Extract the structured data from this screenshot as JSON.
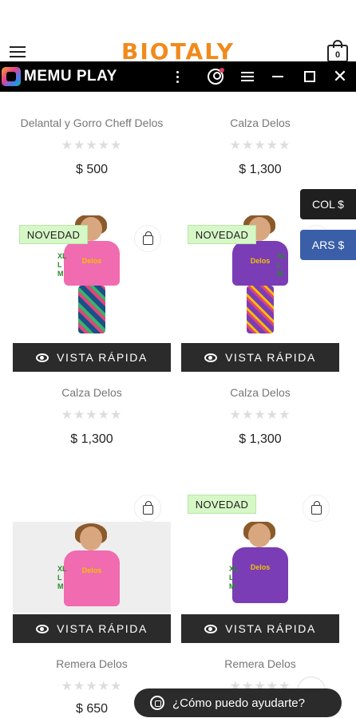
{
  "header": {
    "logo_text": "BIOTALY",
    "cart_count": "0",
    "accent_color": "#f08a1c"
  },
  "emulator_bar": {
    "title": "MEMU PLAY",
    "icons": [
      "memu-logo-icon",
      "kebab-menu-icon",
      "account-icon",
      "menu-lines-icon",
      "minimize-icon",
      "maximize-icon",
      "close-icon"
    ]
  },
  "currency_switcher": {
    "options": [
      "COL $",
      "ARS $"
    ],
    "active": "ARS $"
  },
  "quick_view_label": "VISTA RÁPIDA",
  "badge_label": "NOVEDAD",
  "stars": "★★★★★",
  "products": [
    {
      "name": "Delantal y Gorro Cheff Delos",
      "price": "$ 500",
      "rating": 0
    },
    {
      "name": "Calza Delos",
      "price": "$ 1,300",
      "rating": 0
    },
    {
      "name": "Calza Delos",
      "price": "$ 1,300",
      "rating": 0,
      "badge": true,
      "shirt_color": "#f06bb0",
      "legs_color": "#1b4f8a",
      "print": "Delos"
    },
    {
      "name": "Calza Delos",
      "price": "$ 1,300",
      "rating": 0,
      "badge": true,
      "shirt_color": "#7a3db5",
      "legs_color": "#7a3db5",
      "print": "Delos"
    },
    {
      "name": "Remera Delos",
      "price": "$ 650",
      "rating": 0,
      "badge": false,
      "shirt_color": "#f06bb0",
      "legs_color": "#1b4f8a",
      "print": "Delos"
    },
    {
      "name": "Remera Delos",
      "price": "",
      "rating": 0,
      "badge": true,
      "shirt_color": "#7a3db5",
      "legs_color": "#5a2c8a",
      "print": "Delos"
    }
  ],
  "size_labels": [
    "XL",
    "L",
    "M"
  ],
  "chat_button": {
    "label": "¿Cómo puedo ayudarte?"
  }
}
